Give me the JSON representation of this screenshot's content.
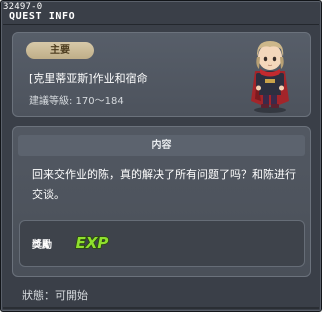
{
  "quest_id": "32497-0",
  "title": "QUEST INFO",
  "header": {
    "badge": "主要",
    "quest_name": "[克里蒂亚斯]作业和宿命",
    "level_text": "建議等級: 170～184",
    "npc_icon": "npc-portrait-icon"
  },
  "content": {
    "section_title": "内容",
    "body": "回来交作业的陈，真的解决了所有问题了吗？和陈进行交谈。"
  },
  "reward": {
    "label": "獎勵",
    "exp_text": "EXP",
    "exp_icon": "exp-icon"
  },
  "status": "狀態：可開始",
  "colors": {
    "window_bg": "#3a3f48",
    "panel_bg": "#525862",
    "badge_bg": "#cbbd97",
    "exp_green": "#8fe02e"
  }
}
